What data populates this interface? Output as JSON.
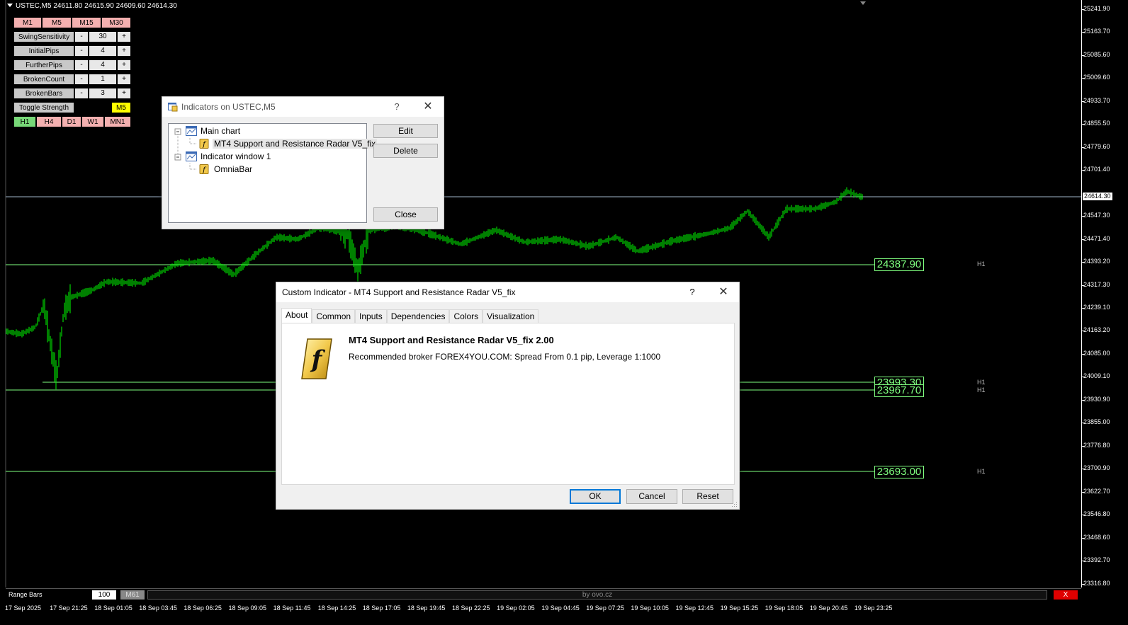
{
  "chart": {
    "symbol_header": "USTEC,M5  24611.80 24615.90 24609.60 24614.30",
    "current_price": "24614.30",
    "colors": {
      "background": "#000000",
      "candles": "#00ff00",
      "levels": "#7fff7f"
    },
    "price_ticks": [
      "25241.90",
      "25163.70",
      "25085.60",
      "25009.60",
      "24933.70",
      "24855.50",
      "24779.60",
      "24701.40",
      "24547.30",
      "24471.40",
      "24393.20",
      "24317.30",
      "24239.10",
      "24163.20",
      "24085.00",
      "24009.10",
      "23930.90",
      "23855.00",
      "23776.80",
      "23700.90",
      "23622.70",
      "23546.80",
      "23468.60",
      "23392.70",
      "23316.80"
    ],
    "time_ticks": [
      "17 Sep 2025",
      "17 Sep 21:25",
      "18 Sep 01:05",
      "18 Sep 03:45",
      "18 Sep 06:25",
      "18 Sep 09:05",
      "18 Sep 11:45",
      "18 Sep 14:25",
      "18 Sep 17:05",
      "18 Sep 19:45",
      "18 Sep 22:25",
      "19 Sep 02:05",
      "19 Sep 04:45",
      "19 Sep 07:25",
      "19 Sep 10:05",
      "19 Sep 12:45",
      "19 Sep 15:25",
      "19 Sep 18:05",
      "19 Sep 20:45",
      "19 Sep 23:25"
    ],
    "levels": [
      {
        "value": "24387.90",
        "tag": "H1"
      },
      {
        "value": "23993.30",
        "tag": "H1"
      },
      {
        "value": "23967.70",
        "tag": "H1"
      },
      {
        "value": "23693.00",
        "tag": "H1"
      }
    ]
  },
  "panel": {
    "tf_top": [
      "M1",
      "M5",
      "M15",
      "M30"
    ],
    "params": [
      {
        "label": "SwingSensitivity",
        "minus": "-",
        "value": "30",
        "plus": "+"
      },
      {
        "label": "InitialPips",
        "minus": "-",
        "value": "4",
        "plus": "+"
      },
      {
        "label": "FurtherPips",
        "minus": "-",
        "value": "4",
        "plus": "+"
      },
      {
        "label": "BrokenCount",
        "minus": "-",
        "value": "1",
        "plus": "+"
      },
      {
        "label": "BrokenBars",
        "minus": "-",
        "value": "3",
        "plus": "+"
      }
    ],
    "toggle_strength": "Toggle Strength",
    "toggle_tf": "M5",
    "tf_bottom": [
      "H1",
      "H4",
      "D1",
      "W1",
      "MN1"
    ]
  },
  "bottom_bar": {
    "label": "Range Bars",
    "input_value": "100",
    "tf": "M61",
    "credit": "by ovo.cz",
    "close": "X"
  },
  "indicators_dialog": {
    "title": "Indicators on USTEC,M5",
    "help": "?",
    "close_glyph": "✕",
    "tree": [
      {
        "label": "Main chart"
      },
      {
        "label": "MT4 Support and Resistance Radar V5_fix"
      },
      {
        "label": "Indicator window 1"
      },
      {
        "label": "OmniaBar"
      }
    ],
    "buttons": {
      "edit": "Edit",
      "delete": "Delete",
      "close": "Close"
    }
  },
  "custom_dialog": {
    "title": "Custom Indicator - MT4 Support and Resistance Radar V5_fix",
    "help": "?",
    "close_glyph": "✕",
    "tabs": [
      "About",
      "Common",
      "Inputs",
      "Dependencies",
      "Colors",
      "Visualization"
    ],
    "active_tab": "About",
    "about_title": "MT4 Support and Resistance Radar V5_fix 2.00",
    "about_desc": "Recommended broker FOREX4YOU.COM: Spread From 0.1 pip, Leverage 1:1000",
    "icon_glyph": "f",
    "buttons": {
      "ok": "OK",
      "cancel": "Cancel",
      "reset": "Reset"
    }
  }
}
